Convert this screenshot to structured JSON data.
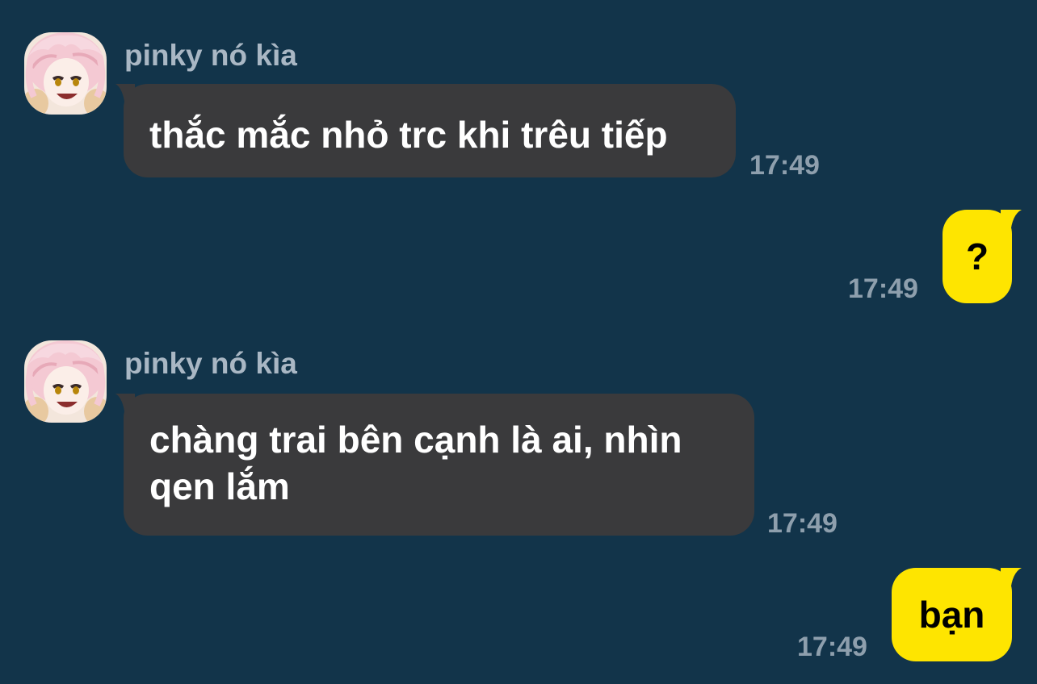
{
  "messages": [
    {
      "sender": "pinky nó kìa",
      "text": "thắc mắc nhỏ trc khi trêu tiếp",
      "time": "17:49"
    },
    {
      "text": "?",
      "time": "17:49"
    },
    {
      "sender": "pinky nó kìa",
      "text_line1": "chàng trai bên cạnh là ai, nhìn",
      "text_line2": "qen lắm",
      "time": "17:49"
    },
    {
      "text": "bạn",
      "time": "17:49"
    }
  ],
  "colors": {
    "background": "#12344a",
    "incoming_bubble": "#3a3a3c",
    "outgoing_bubble": "#fee500",
    "sender_name": "#a9b7c4",
    "timestamp": "#8e9fad"
  },
  "icons": {
    "avatar": "pink-haired-anime-character-avatar"
  }
}
